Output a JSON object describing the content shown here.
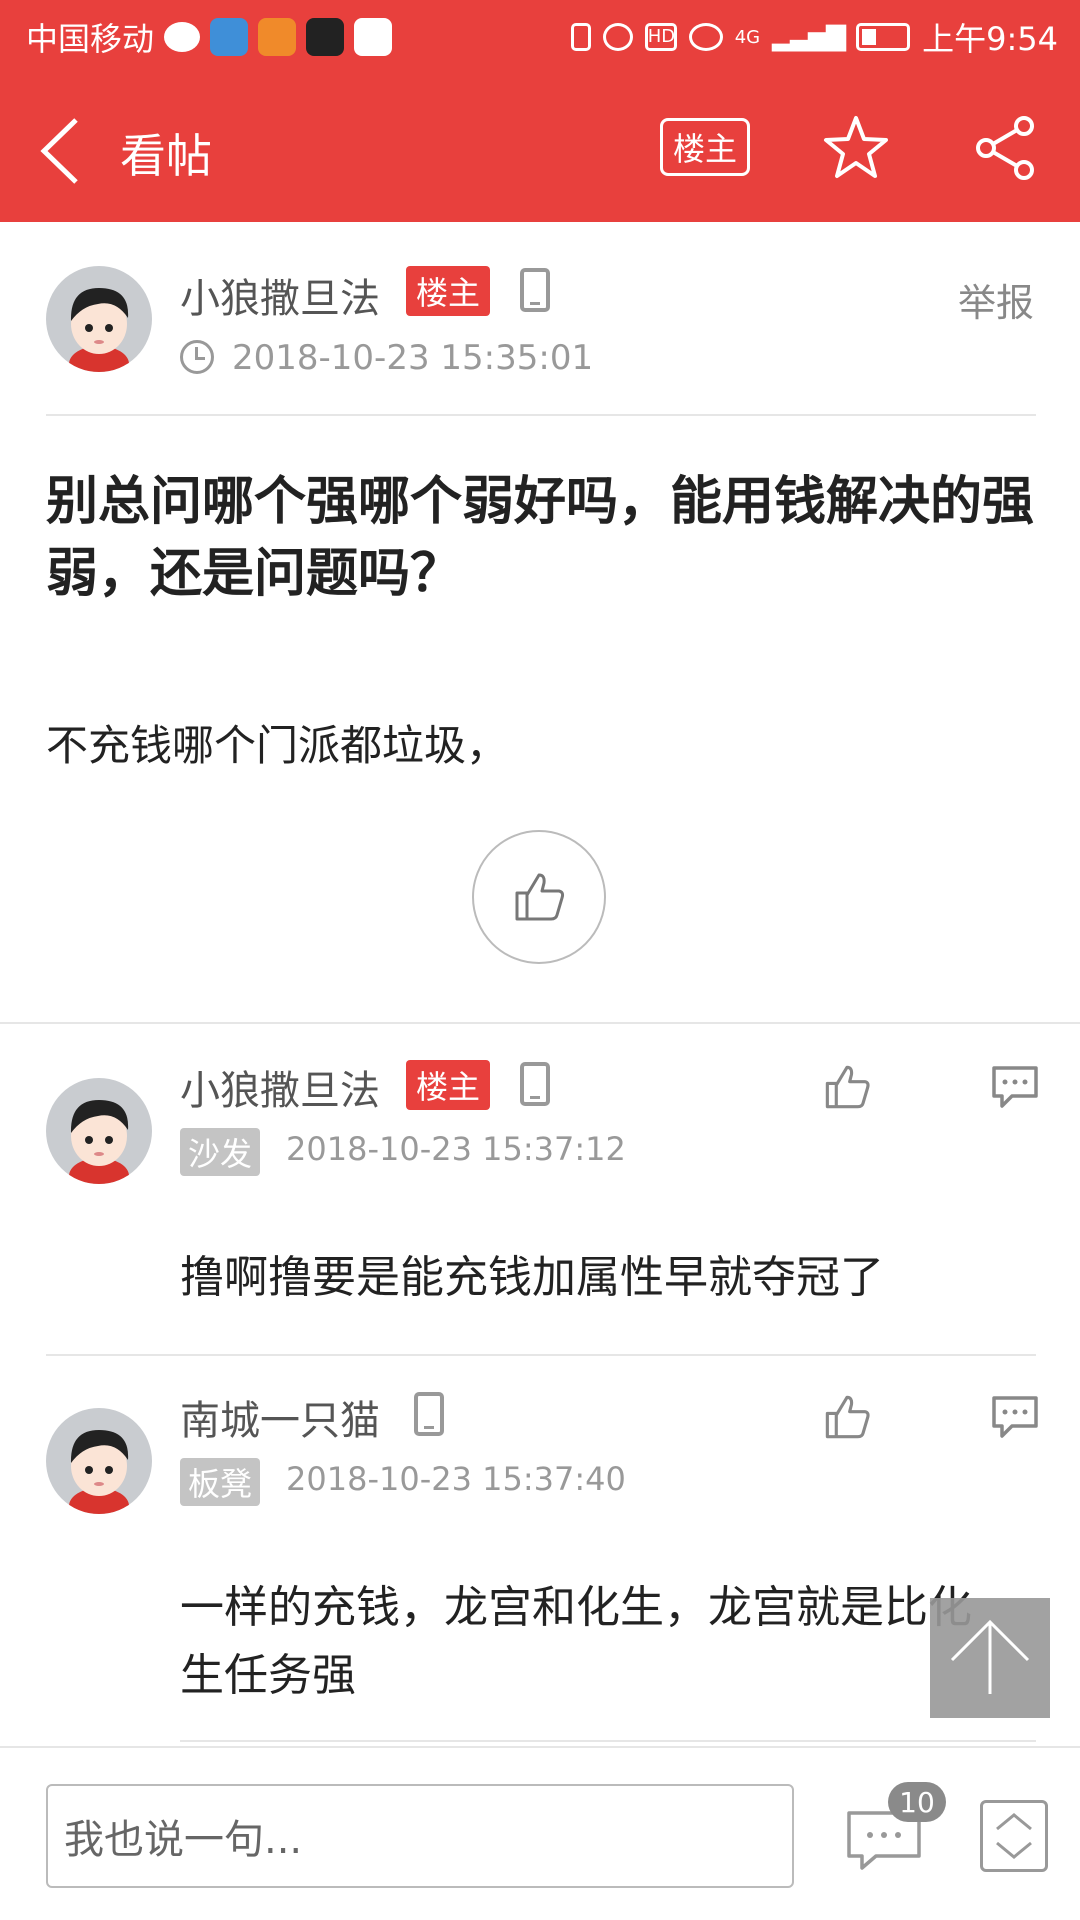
{
  "status_bar": {
    "carrier": "中国移动",
    "time": "上午9:54",
    "network": "4G"
  },
  "header": {
    "title": "看帖",
    "owner_button": "楼主"
  },
  "post": {
    "author": "小狼撒旦法",
    "owner_tag": "楼主",
    "report": "举报",
    "time": "2018-10-23 15:35:01",
    "title": "别总问哪个强哪个弱好吗，能用钱解决的强弱，还是问题吗？",
    "body": "不充钱哪个门派都垃圾，"
  },
  "replies": [
    {
      "author": "小狼撒旦法",
      "owner_tag": "楼主",
      "floor": "沙发",
      "time": "2018-10-23 15:37:12",
      "text": "撸啊撸要是能充钱加属性早就夺冠了"
    },
    {
      "author": "南城一只猫",
      "floor": "板凳",
      "time": "2018-10-23 15:37:40",
      "text": "一样的充钱，龙宫和化生，龙宫就是比化生任务强"
    }
  ],
  "bottom_bar": {
    "input_placeholder": "我也说一句...",
    "comment_count": "10"
  },
  "colors": {
    "accent": "#e8403d",
    "floor_tag": "#c4c4c4"
  }
}
